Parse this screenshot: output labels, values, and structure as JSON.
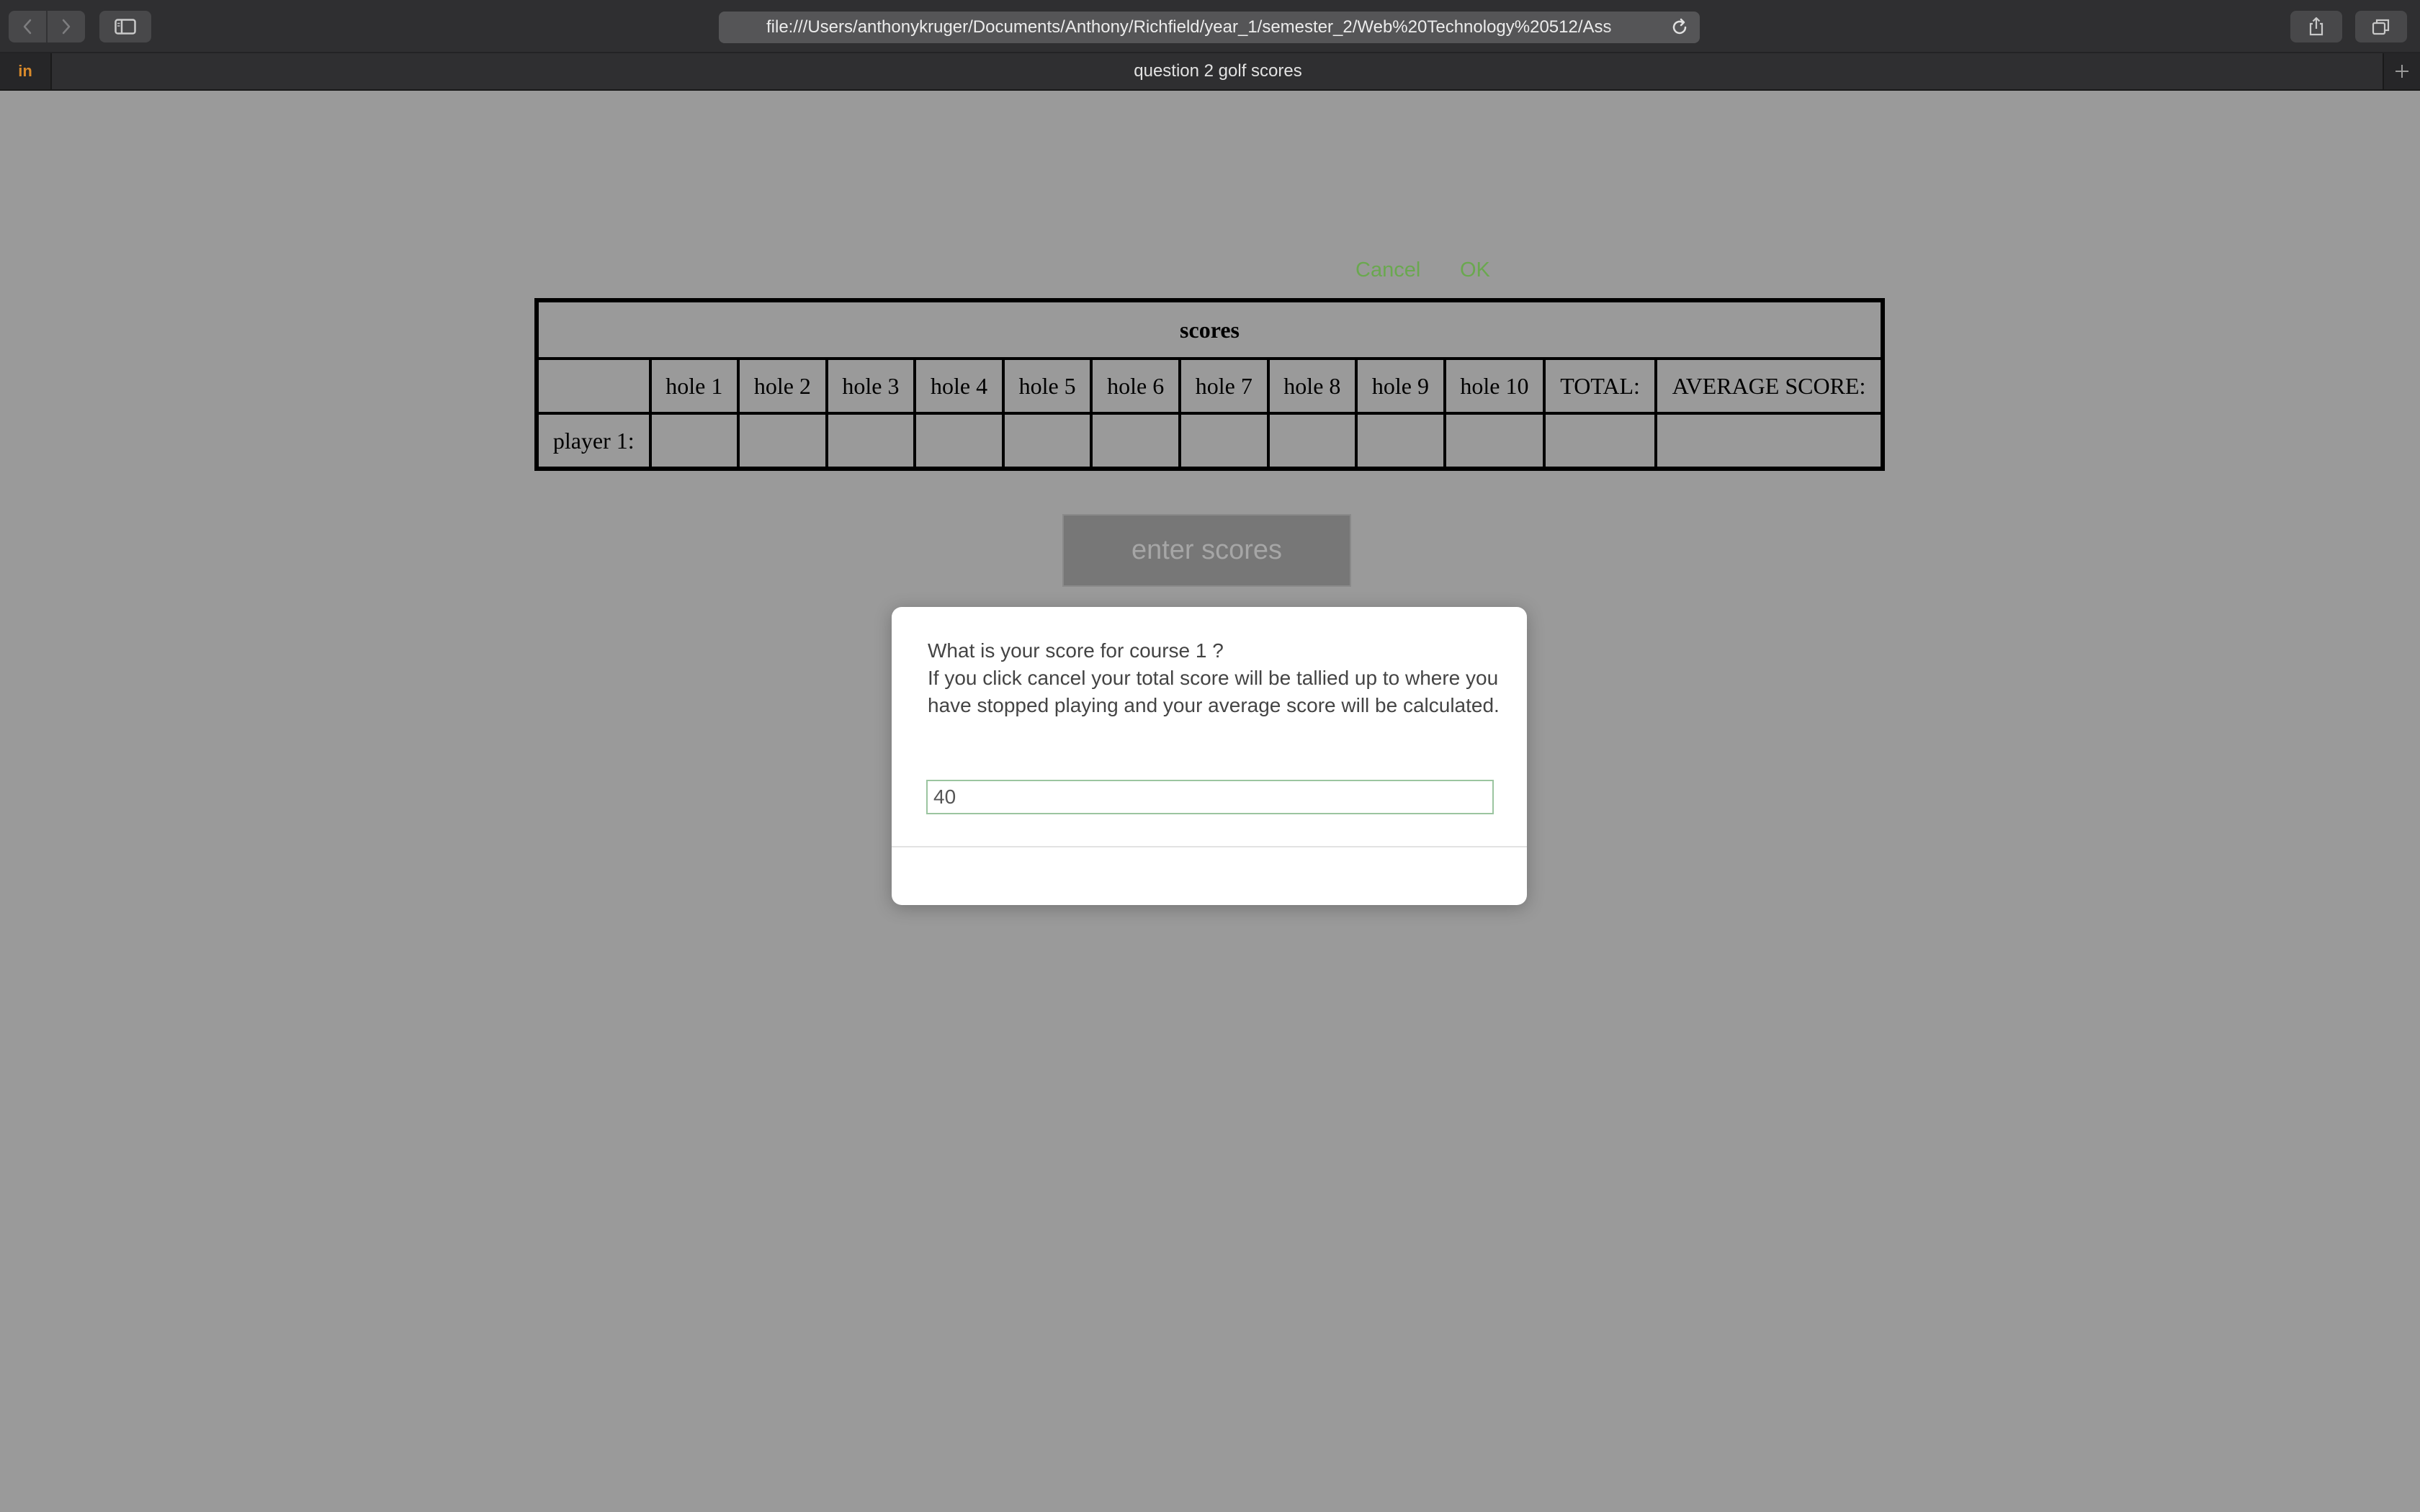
{
  "browser": {
    "url": "file:///Users/anthonykruger/Documents/Anthony/Richfield/year_1/semester_2/Web%20Technology%20512/Ass",
    "tab_title": "question 2 golf scores",
    "pinned_tab_label": "in",
    "accent_color": "#d98a2b"
  },
  "table": {
    "caption": "scores",
    "corner": "",
    "headers": [
      "hole 1",
      "hole 2",
      "hole 3",
      "hole 4",
      "hole 5",
      "hole 6",
      "hole 7",
      "hole 8",
      "hole 9",
      "hole 10",
      "TOTAL:",
      "AVERAGE SCORE:"
    ],
    "rows": [
      {
        "label": "player 1:",
        "cells": [
          "",
          "",
          "",
          "",
          "",
          "",
          "",
          "",
          "",
          "",
          "",
          ""
        ]
      }
    ]
  },
  "page": {
    "enter_button_label": "enter scores"
  },
  "dialog": {
    "message_line1": "What is your score for course 1 ?",
    "message_line2": "If you click cancel your total score will be tallied up to where you have stopped playing and your average score will be calculated.",
    "input_value": "40",
    "cancel_label": "Cancel",
    "ok_label": "OK",
    "button_color": "#6aa84f"
  }
}
